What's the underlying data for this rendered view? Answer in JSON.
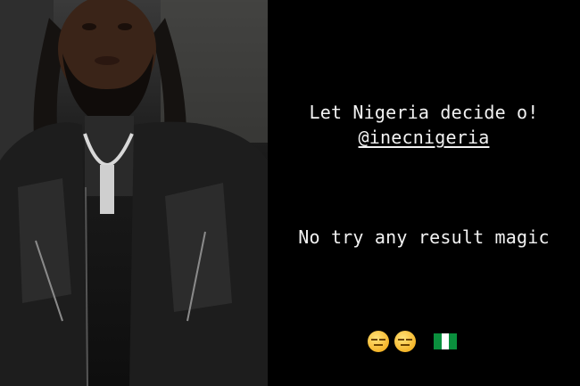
{
  "story": {
    "line1": "Let Nigeria decide o!",
    "mention": "@inecnigeria",
    "line3": "No try any result magic",
    "emojis": [
      "expressionless-face",
      "expressionless-face",
      "nigeria-flag"
    ]
  },
  "colors": {
    "background": "#000000",
    "text": "#f2f2f2",
    "flag_green": "#0a8f3d",
    "flag_white": "#ffffff"
  }
}
